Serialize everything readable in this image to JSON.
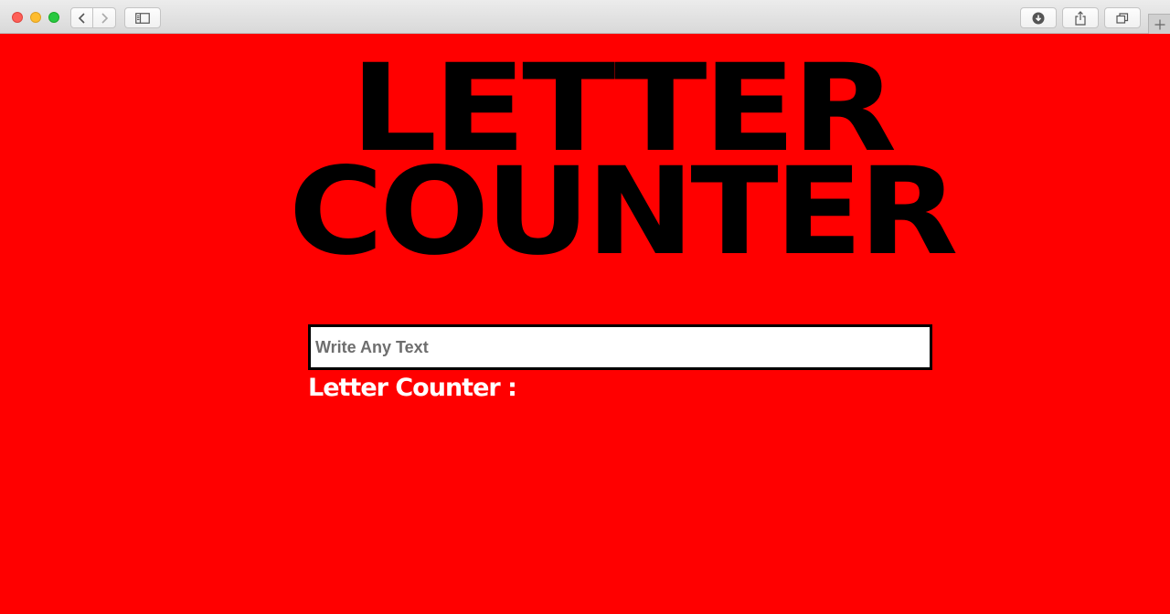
{
  "browser": {
    "toolbar_icons": [
      "back-icon",
      "forward-icon",
      "sidebar-icon",
      "download-icon",
      "share-icon",
      "tabs-icon",
      "plus-icon"
    ]
  },
  "page": {
    "background_color": "#ff0000",
    "title_line1": "LETTER",
    "title_line2": "COUNTER",
    "input": {
      "placeholder": "Write Any Text",
      "value": ""
    },
    "counter_label": "Letter Counter :",
    "counter_value": ""
  }
}
